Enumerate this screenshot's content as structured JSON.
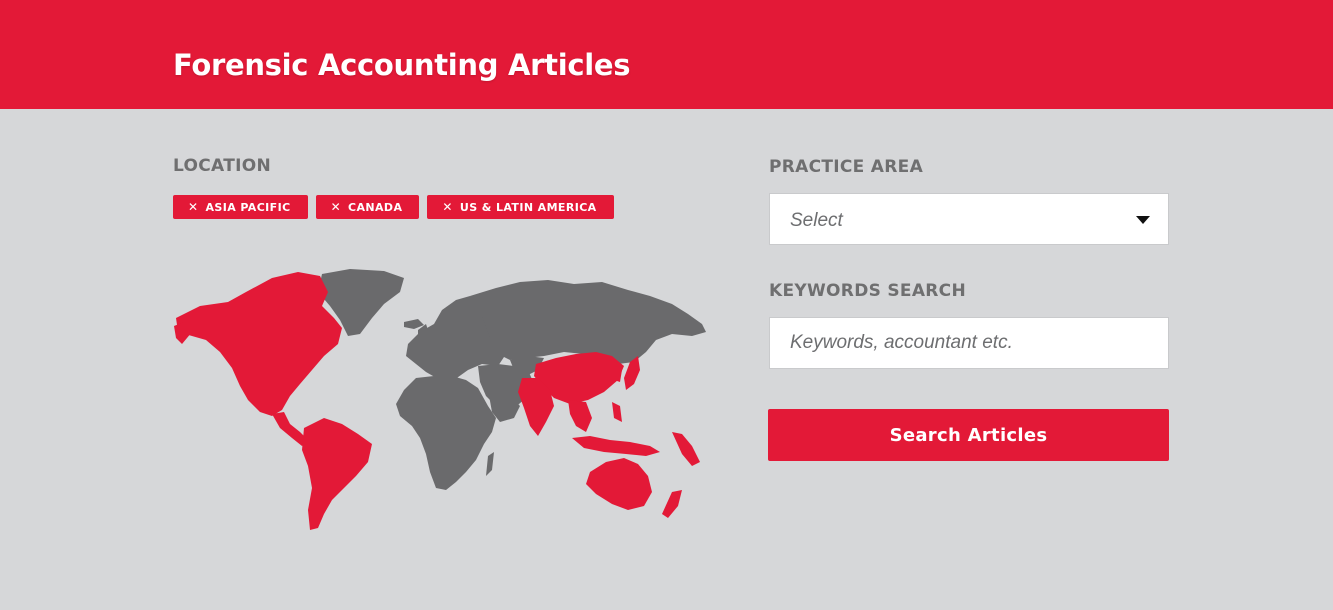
{
  "header": {
    "title": "Forensic Accounting Articles"
  },
  "filters": {
    "location": {
      "label": "LOCATION",
      "selected": [
        "ASIA PACIFIC",
        "CANADA",
        "US & LATIN AMERICA"
      ],
      "remove_icon": "close-icon"
    },
    "practice_area": {
      "label": "PRACTICE AREA",
      "value": "Select",
      "icon": "caret-down-icon"
    },
    "keywords": {
      "label": "KEYWORDS SEARCH",
      "placeholder": "Keywords, accountant etc.",
      "value": ""
    },
    "submit_label": "Search Articles"
  },
  "map": {
    "highlighted_regions": [
      "North America",
      "Latin America",
      "Asia Pacific"
    ],
    "colors": {
      "highlight": "#e31937",
      "default": "#6a6a6c"
    }
  },
  "theme": {
    "accent": "#e31937",
    "background": "#d6d7d9"
  }
}
